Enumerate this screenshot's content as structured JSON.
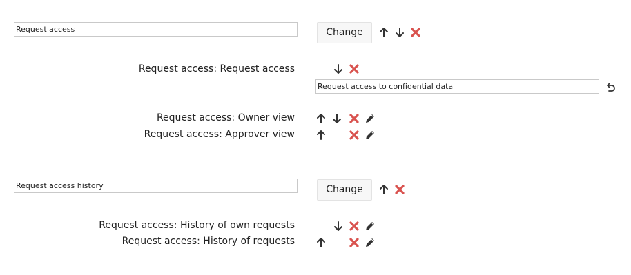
{
  "groups": [
    {
      "name_value": "Request access",
      "change_label": "Change",
      "actions": [
        {
          "label": "Request access: Request access",
          "edit_value": "Request access to confidential data"
        },
        {
          "label": "Request access: Owner view"
        },
        {
          "label": "Request access: Approver view"
        }
      ]
    },
    {
      "name_value": "Request access history",
      "change_label": "Change",
      "actions": [
        {
          "label": "Request access: History of own requests"
        },
        {
          "label": "Request access: History of requests"
        }
      ]
    }
  ],
  "icons": {
    "up": "arrow-up-icon",
    "down": "arrow-down-icon",
    "delete": "delete-cross-icon",
    "edit": "pencil-icon",
    "undo": "undo-icon"
  },
  "colors": {
    "delete": "#d9534f",
    "icon": "#333333"
  }
}
